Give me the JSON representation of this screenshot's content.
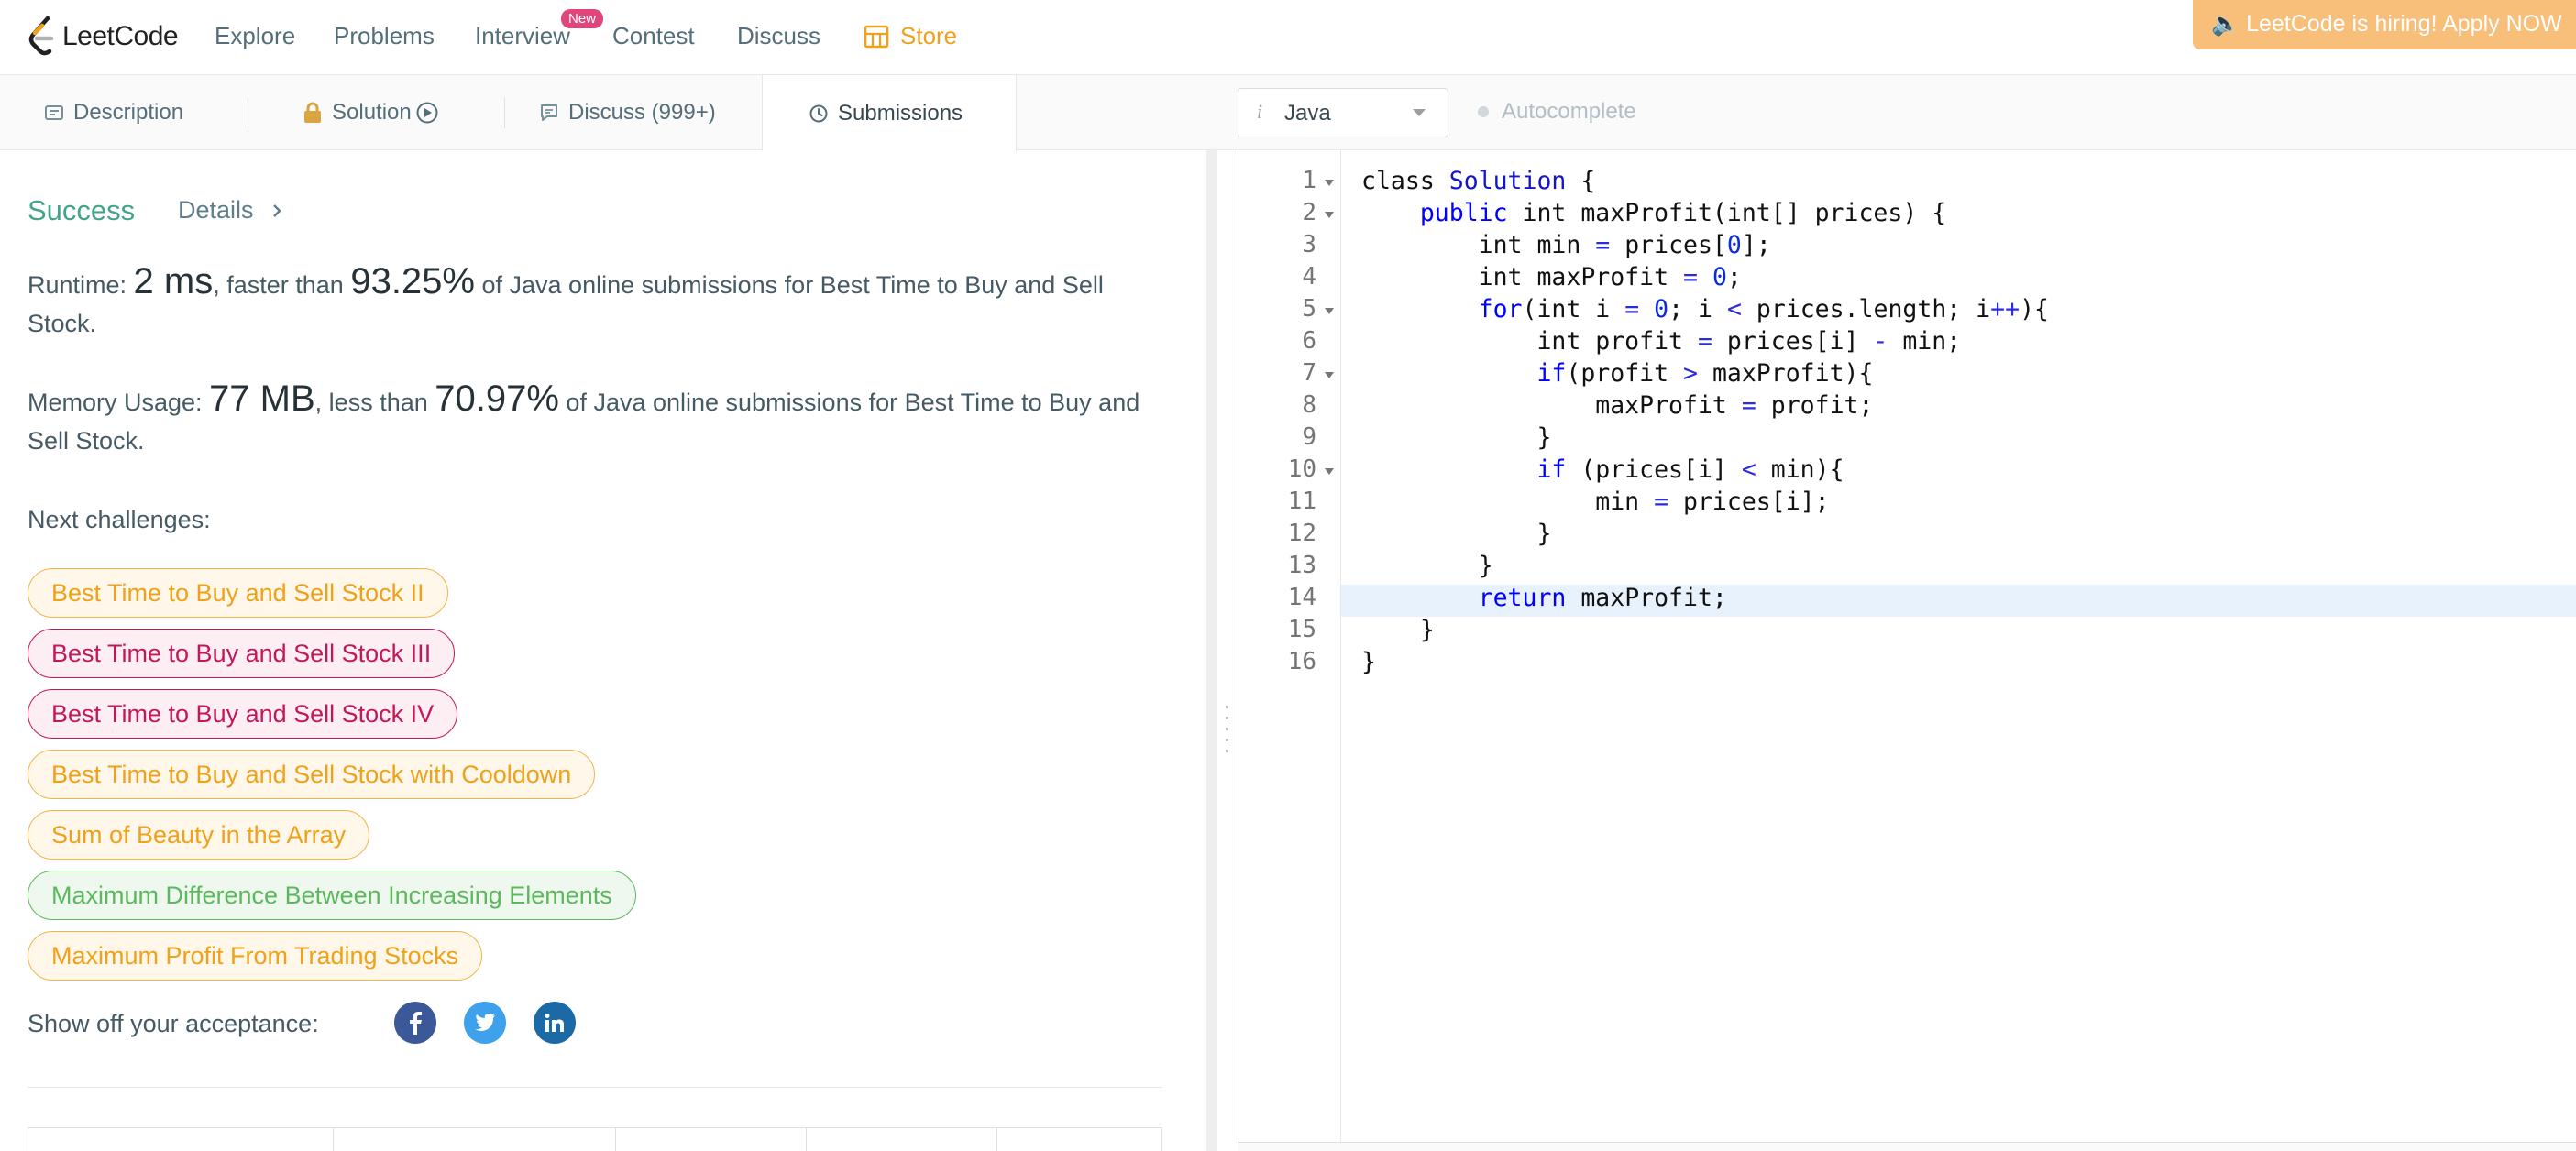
{
  "nav": {
    "brand": "LeetCode",
    "items": [
      "Explore",
      "Problems",
      "Interview",
      "Contest",
      "Discuss"
    ],
    "new_badge": "New",
    "store": "Store",
    "hiring": "🔈 LeetCode is hiring! Apply NOW"
  },
  "tabs": {
    "description": "Description",
    "solution": "Solution",
    "discuss": "Discuss (999+)",
    "submissions": "Submissions"
  },
  "editor_toolbar": {
    "language": "Java",
    "autocomplete": "Autocomplete"
  },
  "result": {
    "status": "Success",
    "details": "Details",
    "runtime_label": "Runtime: ",
    "runtime_value": "2 ms",
    "runtime_mid": ", faster than ",
    "runtime_pct": "93.25%",
    "runtime_tail": " of Java online submissions for Best Time to Buy and Sell Stock.",
    "memory_label": "Memory Usage: ",
    "memory_value": "77 MB",
    "memory_mid": ", less than ",
    "memory_pct": "70.97%",
    "memory_tail": " of Java online submissions for Best Time to Buy and Sell Stock."
  },
  "next_challenges": {
    "label": "Next challenges:",
    "items": [
      {
        "title": "Best Time to Buy and Sell Stock II",
        "difficulty": "medium"
      },
      {
        "title": "Best Time to Buy and Sell Stock III",
        "difficulty": "hard"
      },
      {
        "title": "Best Time to Buy and Sell Stock IV",
        "difficulty": "hard"
      },
      {
        "title": "Best Time to Buy and Sell Stock with Cooldown",
        "difficulty": "medium"
      },
      {
        "title": "Sum of Beauty in the Array",
        "difficulty": "medium"
      },
      {
        "title": "Maximum Difference Between Increasing Elements",
        "difficulty": "easy"
      },
      {
        "title": "Maximum Profit From Trading Stocks",
        "difficulty": "medium"
      }
    ]
  },
  "share": {
    "label": "Show off your acceptance:",
    "icons": [
      "facebook-icon",
      "twitter-icon",
      "linkedin-icon"
    ]
  },
  "code": {
    "line_numbers": [
      "1",
      "2",
      "3",
      "4",
      "5",
      "6",
      "7",
      "8",
      "9",
      "10",
      "11",
      "12",
      "13",
      "14",
      "15",
      "16"
    ],
    "folds": [
      "1",
      "2",
      "5",
      "7",
      "10"
    ],
    "highlighted_line": "14",
    "lines": [
      "class Solution {",
      "    public int maxProfit(int[] prices) {",
      "        int min = prices[0];",
      "        int maxProfit = 0;",
      "        for(int i = 0; i < prices.length; i++){",
      "            int profit = prices[i] - min;",
      "            if(profit > maxProfit){",
      "                maxProfit = profit;",
      "            }",
      "            if (prices[i] < min){",
      "                min = prices[i];",
      "            }",
      "        }",
      "        return maxProfit;",
      "    }",
      "}"
    ]
  },
  "colors": {
    "accent_orange": "#f0a11a",
    "success_green": "#43a48a",
    "hard_pink": "#c2185b",
    "easy_green": "#5cb85c",
    "keyword_blue": "#0000ff"
  }
}
